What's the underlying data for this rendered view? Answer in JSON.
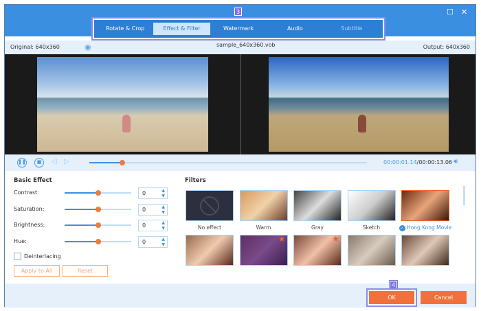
{
  "window": {
    "file_name": "sample_640x360.vob",
    "original": "Original: 640x360",
    "output": "Output: 640x360"
  },
  "tabs": [
    {
      "label": "Rotate & Crop"
    },
    {
      "label": "Effect & Filter",
      "active": true
    },
    {
      "label": "Watermark"
    },
    {
      "label": "Audio"
    },
    {
      "label": "Subtitle"
    }
  ],
  "step_badges": {
    "tabs": "3",
    "ok": "4"
  },
  "player": {
    "current_time": "00:00:01.14",
    "total_time": "/00:00:13.06",
    "progress_percent": 12
  },
  "basic_effect": {
    "title": "Basic Effect",
    "rows": [
      {
        "label": "Contrast:",
        "value": "0",
        "slider_percent": 50
      },
      {
        "label": "Saturation:",
        "value": "0",
        "slider_percent": 50
      },
      {
        "label": "Brightness:",
        "value": "0",
        "slider_percent": 50
      },
      {
        "label": "Hue:",
        "value": "0",
        "slider_percent": 50
      }
    ],
    "deinterlacing": "Deinterlacing",
    "deinterlacing_checked": false,
    "apply_to_all": "Apply to All",
    "reset": "Reset"
  },
  "filters": {
    "title": "Filters",
    "items": [
      {
        "label": "No effect"
      },
      {
        "label": "Warm"
      },
      {
        "label": "Gray"
      },
      {
        "label": "Sketch"
      },
      {
        "label": "Hong Kong Movie",
        "selected": true
      },
      {
        "label": ""
      },
      {
        "label": "",
        "star": true
      },
      {
        "label": "",
        "star": true
      },
      {
        "label": ""
      },
      {
        "label": ""
      }
    ]
  },
  "footer": {
    "ok": "OK",
    "cancel": "Cancel"
  },
  "colors": {
    "accent": "#3b8fe0",
    "orange": "#f0713b",
    "badge": "#7a73e8"
  }
}
